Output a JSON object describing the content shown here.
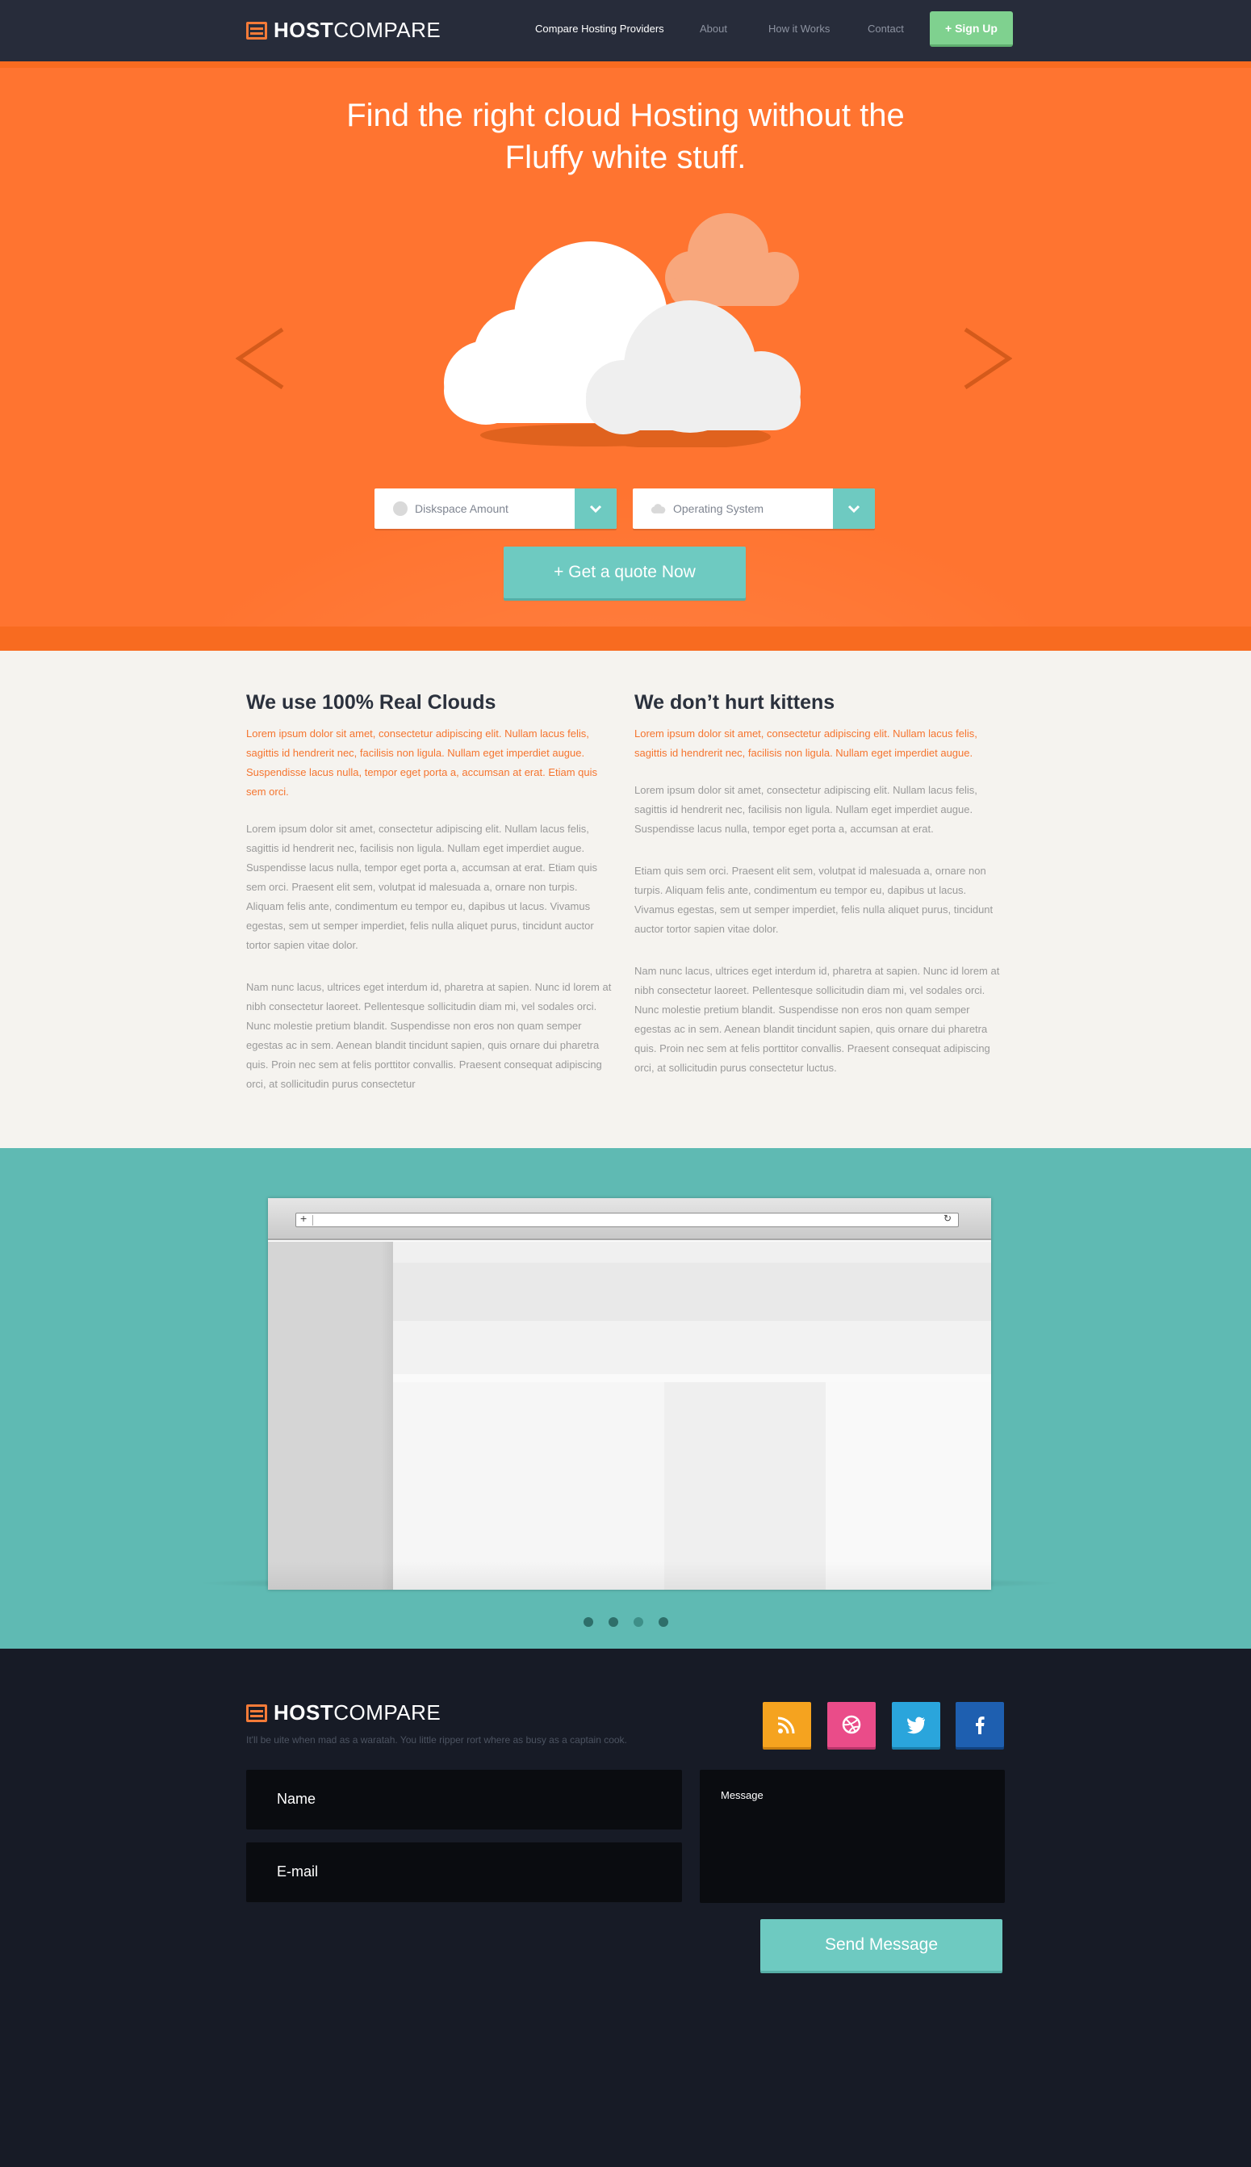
{
  "brand": {
    "logo_bold": "HOST",
    "logo_light": "COMPARE",
    "accent_color": "#ff7430",
    "teal_color": "#6ecac1",
    "dark_color": "#272c3a"
  },
  "nav": {
    "links": [
      {
        "label": "Compare Hosting  Providers",
        "active": true
      },
      {
        "label": "About",
        "active": false
      },
      {
        "label": "How it Works",
        "active": false
      },
      {
        "label": "Contact",
        "active": false
      }
    ],
    "signup_label": "+ Sign Up"
  },
  "hero": {
    "title_line1": "Find the right cloud Hosting without the",
    "title_line2": "Fluffy white stuff.",
    "prev_icon": "chevron-left-icon",
    "next_icon": "chevron-right-icon",
    "diskspace_placeholder": "Diskspace Amount",
    "os_placeholder": "Operating System",
    "quote_button": "+ Get a quote Now"
  },
  "features": {
    "left": {
      "title": "We use 100% Real Clouds",
      "lead": "Lorem ipsum dolor sit amet, consectetur adipiscing elit. Nullam lacus felis, sagittis id hendrerit nec, facilisis non ligula. Nullam eget imperdiet augue. Suspendisse lacus nulla, tempor eget porta a, accumsan at erat. Etiam quis sem orci.",
      "paragraphs": [
        "Lorem ipsum dolor sit amet, consectetur adipiscing elit. Nullam lacus felis, sagittis id hendrerit nec, facilisis non ligula. Nullam eget imperdiet augue. Suspendisse lacus nulla, tempor eget porta a, accumsan at erat. Etiam quis sem orci. Praesent elit sem, volutpat id malesuada a, ornare non turpis. Aliquam felis ante, condimentum eu tempor eu, dapibus ut lacus. Vivamus egestas, sem ut semper imperdiet, felis nulla aliquet purus, tincidunt auctor tortor sapien vitae dolor.",
        "Nam nunc lacus, ultrices eget interdum id, pharetra at sapien. Nunc id lorem at nibh consectetur laoreet. Pellentesque sollicitudin diam mi, vel sodales orci. Nunc molestie pretium blandit. Suspendisse non eros non quam semper egestas ac in sem. Aenean blandit tincidunt sapien, quis ornare dui pharetra quis. Proin nec sem at felis porttitor convallis. Praesent consequat adipiscing orci, at sollicitudin purus consectetur"
      ]
    },
    "right": {
      "title": "We don’t hurt kittens",
      "lead": "Lorem ipsum dolor sit amet, consectetur adipiscing elit. Nullam lacus felis, sagittis id hendrerit nec, facilisis non ligula. Nullam eget imperdiet augue.",
      "paragraphs": [
        "Lorem ipsum dolor sit amet, consectetur adipiscing elit. Nullam lacus felis, sagittis id hendrerit nec, facilisis non ligula. Nullam eget imperdiet augue. Suspendisse lacus nulla, tempor eget porta a, accumsan at erat.",
        "Etiam quis sem orci. Praesent elit sem, volutpat id malesuada a, ornare non turpis. Aliquam felis ante, condimentum eu tempor eu, dapibus ut lacus. Vivamus egestas, sem ut semper imperdiet, felis nulla aliquet purus, tincidunt auctor tortor sapien vitae dolor.",
        "Nam nunc lacus, ultrices eget interdum id, pharetra at sapien. Nunc id lorem at nibh consectetur laoreet. Pellentesque sollicitudin diam mi, vel sodales orci. Nunc molestie pretium blandit. Suspendisse non eros non quam semper egestas ac in sem. Aenean blandit tincidunt sapien, quis ornare dui pharetra quis. Proin nec sem at felis porttitor convallis. Praesent consequat adipiscing orci, at sollicitudin purus consectetur luctus."
      ]
    }
  },
  "showcase": {
    "browser_plus": "+",
    "browser_reload": "↻",
    "slides": [
      {
        "active": true
      },
      {
        "active": true
      },
      {
        "active": false
      },
      {
        "active": true
      }
    ]
  },
  "footer": {
    "tagline": "It'll be uite when mad as a waratah. You little ripper rort where as busy as a captain cook.",
    "social": [
      "rss-icon",
      "dribbble-icon",
      "twitter-icon",
      "facebook-icon"
    ],
    "name_placeholder": "Name",
    "email_placeholder": "E-mail",
    "message_placeholder": "Message",
    "send_button": "Send Message"
  }
}
